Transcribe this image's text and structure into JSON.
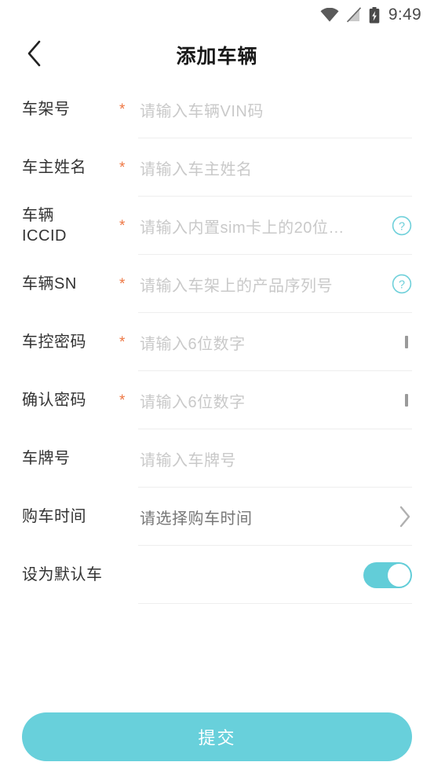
{
  "status_bar": {
    "wifi_icon": "wifi-icon",
    "signal_icon": "signal-off-icon",
    "battery_icon": "battery-charging-icon",
    "time": "9:49"
  },
  "header": {
    "back_icon": "chevron-left-icon",
    "title": "添加车辆"
  },
  "colors": {
    "accent": "#68d0db",
    "required_star": "#ee7744",
    "label": "#333333",
    "placeholder": "#c9c9c9",
    "separator": "#eeeeee"
  },
  "form": {
    "required_mark": "*",
    "rows": [
      {
        "label": "车架号",
        "required": true,
        "placeholder": "请输入车辆VIN码",
        "value": "",
        "trailing": "none"
      },
      {
        "label": "车主姓名",
        "required": true,
        "placeholder": "请输入车主姓名",
        "value": "",
        "trailing": "none"
      },
      {
        "label": "车辆\nICCID",
        "required": true,
        "placeholder": "请输入内置sim卡上的20位…",
        "value": "",
        "trailing": "help"
      },
      {
        "label": "车辆SN",
        "required": true,
        "placeholder": "请输入车架上的产品序列号",
        "value": "",
        "trailing": "help"
      },
      {
        "label": "车控密码",
        "required": true,
        "placeholder": "请输入6位数字",
        "value": "",
        "trailing": "eye"
      },
      {
        "label": "确认密码",
        "required": true,
        "placeholder": "请输入6位数字",
        "value": "",
        "trailing": "eye"
      },
      {
        "label": "车牌号",
        "required": false,
        "placeholder": "请输入车牌号",
        "value": "",
        "trailing": "none"
      },
      {
        "label": "购车时间",
        "required": false,
        "placeholder": "请选择购车时间",
        "value": "",
        "trailing": "chevron"
      },
      {
        "label": "设为默认车",
        "required": false,
        "placeholder": "",
        "value": "",
        "trailing": "toggle",
        "toggle_on": true
      }
    ]
  },
  "footer": {
    "submit_label": "提交"
  }
}
